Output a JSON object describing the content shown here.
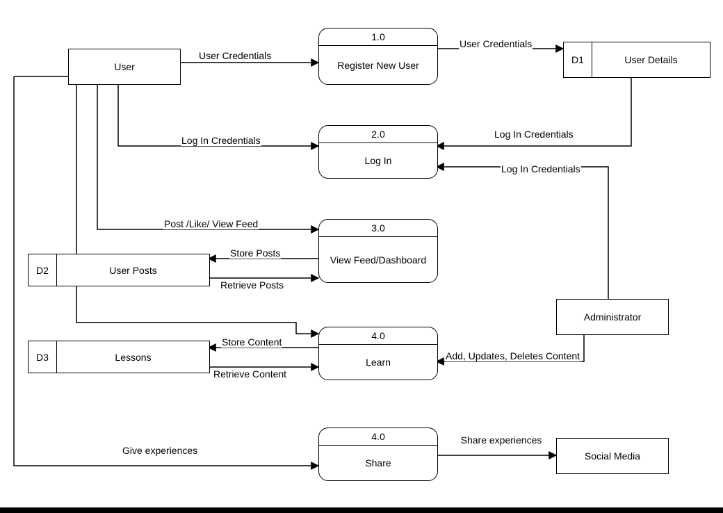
{
  "entities": {
    "user": "User",
    "admin": "Administrator",
    "social": "Social Media"
  },
  "processes": {
    "p1": {
      "num": "1.0",
      "name": "Register New User"
    },
    "p2": {
      "num": "2.0",
      "name": "Log In"
    },
    "p3": {
      "num": "3.0",
      "name": "View Feed/Dashboard"
    },
    "p4": {
      "num": "4.0",
      "name": "Learn"
    },
    "p5": {
      "num": "4.0",
      "name": "Share"
    }
  },
  "datastores": {
    "d1": {
      "id": "D1",
      "name": "User Details"
    },
    "d2": {
      "id": "D2",
      "name": "User Posts"
    },
    "d3": {
      "id": "D3",
      "name": "Lessons"
    }
  },
  "flows": {
    "f1": "User Credentials",
    "f2": "User Credentials",
    "f3": "Log In Credentials",
    "f4": "Log In Credentials",
    "f5": "Log In Credentials",
    "f6": "Post /Like/  View Feed",
    "f7": "Store Posts",
    "f8": "Retrieve Posts",
    "f9": "Store Content",
    "f10": "Retrieve Content",
    "f11": "Add, Updates, Deletes Content",
    "f12": "Give experiences",
    "f13": "Share experiences"
  }
}
